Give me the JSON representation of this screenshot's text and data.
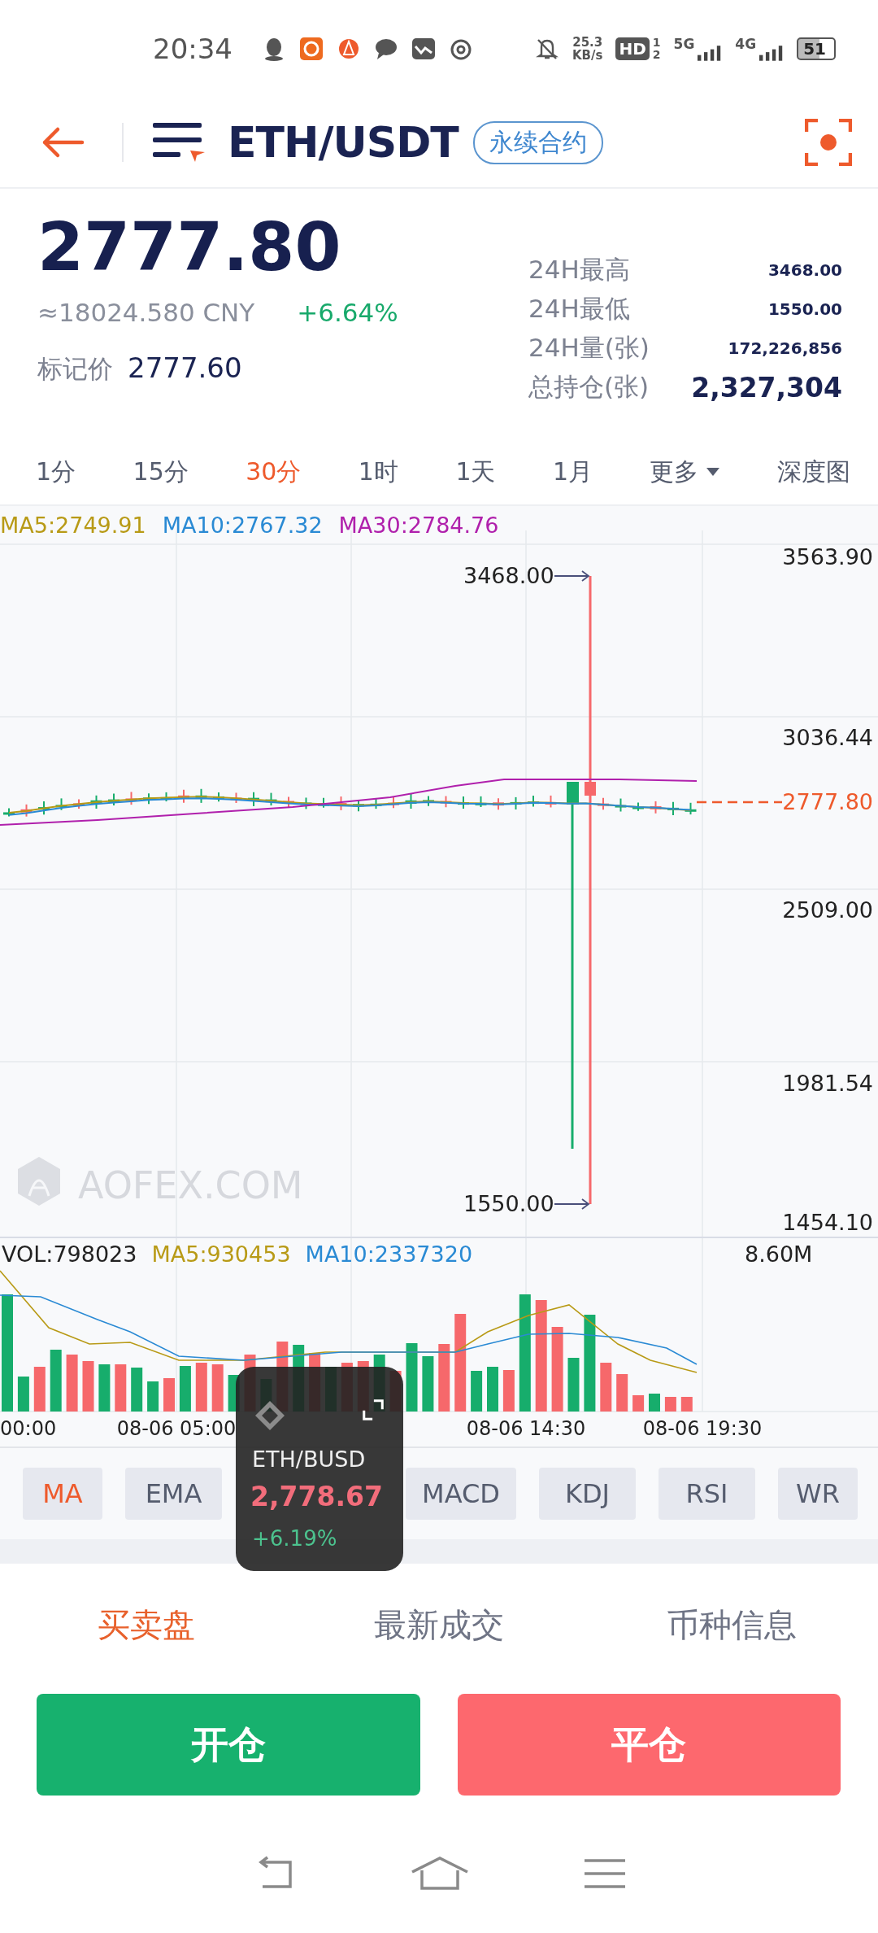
{
  "status_bar": {
    "time": "20:34",
    "net_speed": "25.3",
    "net_speed_unit": "KB/s",
    "hd_label": "HD",
    "sim_slots": [
      "1",
      "2"
    ],
    "networks": [
      {
        "label": "5G"
      },
      {
        "label": "4G"
      }
    ],
    "battery": "51"
  },
  "header": {
    "title": "ETH/USDT",
    "badge": "永续合约"
  },
  "ticker": {
    "price": "2777.80",
    "cny": "≈18024.580 CNY",
    "change": "+6.64%",
    "mark_label": "标记价",
    "mark_price": "2777.60",
    "stats": [
      {
        "label": "24H最高",
        "value": "3468.00",
        "kind": "small"
      },
      {
        "label": "24H最低",
        "value": "1550.00",
        "kind": "small"
      },
      {
        "label": "24H量(张)",
        "value": "172,226,856",
        "kind": "small"
      },
      {
        "label": "总持仓(张)",
        "value": "2,327,304",
        "kind": "large"
      }
    ]
  },
  "timeframes": [
    {
      "label": "1分",
      "kind": "interval",
      "selected": false
    },
    {
      "label": "15分",
      "kind": "interval",
      "selected": false
    },
    {
      "label": "30分",
      "kind": "interval",
      "selected": true
    },
    {
      "label": "1时",
      "kind": "interval",
      "selected": false
    },
    {
      "label": "1天",
      "kind": "interval",
      "selected": false
    },
    {
      "label": "1月",
      "kind": "interval",
      "selected": false
    },
    {
      "label": "更多",
      "kind": "menu",
      "selected": false
    },
    {
      "label": "深度图",
      "kind": "depth",
      "selected": false
    }
  ],
  "chart": {
    "legend": [
      {
        "text": "MA5:2749.91",
        "color": "#b89a16"
      },
      {
        "text": "MA10:2767.32",
        "color": "#2a8ad4"
      },
      {
        "text": "MA30:2784.76",
        "color": "#b020ac"
      }
    ],
    "price_labels": [
      "3563.90",
      "3036.44",
      "2509.00",
      "1981.54",
      "1454.10"
    ],
    "last_price": "2777.80",
    "high_marker": "3468.00",
    "low_marker": "1550.00",
    "watermark": "AOFEX.COM"
  },
  "volume": {
    "legend": [
      {
        "text": "VOL:798023",
        "color": "#222222"
      },
      {
        "text": "MA5:930453",
        "color": "#b89a16"
      },
      {
        "text": "MA10:2337320",
        "color": "#2a8ad4"
      }
    ],
    "max_label": "8.60M",
    "time_labels": [
      "00:00",
      "08-06 05:00",
      "08-06 14:30",
      "08-06 19:30"
    ]
  },
  "indicators": [
    {
      "label": "MA",
      "kind": "button",
      "selected": true
    },
    {
      "label": "EMA",
      "kind": "button",
      "selected": false
    },
    {
      "label": "MACD",
      "kind": "button",
      "selected": false
    },
    {
      "label": "KDJ",
      "kind": "button",
      "selected": false
    },
    {
      "label": "RSI",
      "kind": "button",
      "selected": false
    },
    {
      "label": "WR",
      "kind": "button",
      "selected": false
    }
  ],
  "floating_ticker": {
    "pair": "ETH/BUSD",
    "price": "2,778.67",
    "change": "+6.19%"
  },
  "bottom_tabs": [
    {
      "label": "买卖盘",
      "selected": true
    },
    {
      "label": "最新成交",
      "selected": false
    },
    {
      "label": "币种信息",
      "selected": false
    }
  ],
  "actions": [
    {
      "label": "开仓",
      "kind": "open"
    },
    {
      "label": "平仓",
      "kind": "close"
    }
  ]
}
